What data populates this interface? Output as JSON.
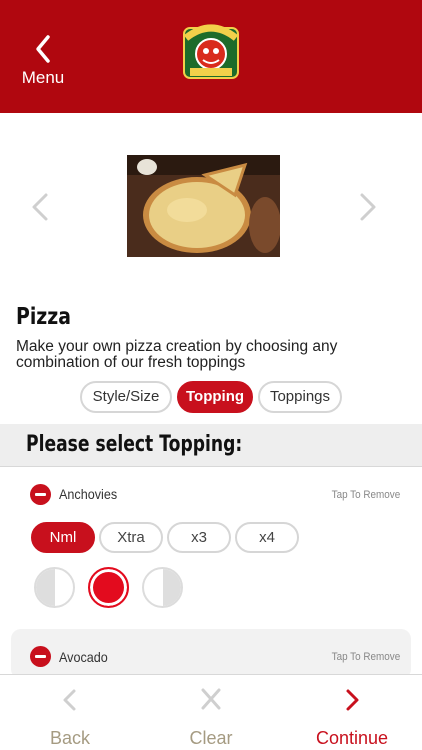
{
  "header": {
    "back_label": "Menu",
    "brand_color": "#b0070f"
  },
  "item": {
    "title": "Pizza",
    "description": "Make your own pizza creation by choosing any combination of our fresh toppings"
  },
  "tabs": [
    {
      "label": "Style/Size",
      "active": false
    },
    {
      "label": "Topping",
      "active": true
    },
    {
      "label": "Toppings",
      "active": false
    }
  ],
  "section": {
    "title": "Please select Topping:"
  },
  "toppings": [
    {
      "name": "Anchovies",
      "action": "Tap To Remove",
      "quantities": [
        "Nml",
        "Xtra",
        "x3",
        "x4"
      ],
      "selected_quantity": "Nml",
      "selected_portion": "whole"
    },
    {
      "name": "Avocado",
      "action": "Tap To Remove"
    }
  ],
  "footer": {
    "back_label": "Back",
    "clear_label": "Clear",
    "continue_label": "Continue"
  },
  "icons": {
    "back": "chevron-left-icon",
    "clear": "close-icon",
    "continue": "chevron-right-icon"
  },
  "colors": {
    "accent": "#c8101d",
    "muted_label": "#a59b82"
  }
}
